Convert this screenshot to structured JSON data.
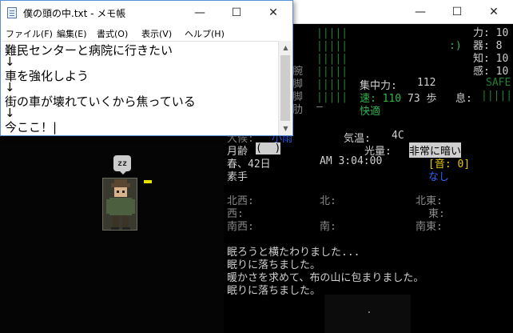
{
  "notepad": {
    "title": "僕の頭の中.txt - メモ帳",
    "menu": [
      "ファイル(F)",
      "編集(E)",
      "書式(O)",
      "表示(V)",
      "ヘルプ(H)"
    ],
    "lines": [
      "難民センターと病院に行きたい",
      "↓",
      "車を強化しよう",
      "↓",
      "街の車が壊れていくから焦っている",
      "↓",
      "今ここ！|"
    ]
  },
  "window_controls": {
    "minimize": "—",
    "maximize": "☐",
    "close": "✕"
  },
  "map": {
    "sleep_label": "zz"
  },
  "sidebar": {
    "stats": {
      "str": "力: 10",
      "dex": "器: 8",
      "int": "知: 10",
      "per": "感: 10"
    },
    "safe_mode": "SAFE",
    "smiley": ":)",
    "focus_label": "集中力:",
    "focus_value": "112",
    "speed": "速: 110",
    "moves": "73 歩",
    "breath": "息:",
    "mood": "快適",
    "temp_label": "気温:",
    "temp_value": "4C",
    "moon_label": "月齢",
    "moon_value": "(  )",
    "light_label": "光量:",
    "light_value": "非常に暗い",
    "season_day": "春、42日",
    "time": "AM 3:04:00",
    "sound": "[音: 0]",
    "weapon": "素手",
    "style": "なし",
    "partial_weather": "大候:",
    "partial_sky": "小雨",
    "directions": {
      "nw": "北西:",
      "n": "北:",
      "ne": "北東:",
      "w": "西:",
      "e": "東:",
      "sw": "南西:",
      "s": "南:",
      "se": "南東:"
    },
    "log": [
      "眠ろうと横たわりました...",
      "眠りに落ちました。",
      "暖かさを求めて、布の山に包まりました。",
      "眠りに落ちました。"
    ],
    "bar_marks": "|||||",
    "partial_body": [
      "腕",
      "脚",
      "脚",
      "肋"
    ],
    "dash": "—",
    "dot": "."
  },
  "colors": {
    "green": "#2fb84a",
    "blue": "#2b62ff",
    "yellow": "#e6c800",
    "light_bg": "#cfcfcf"
  }
}
